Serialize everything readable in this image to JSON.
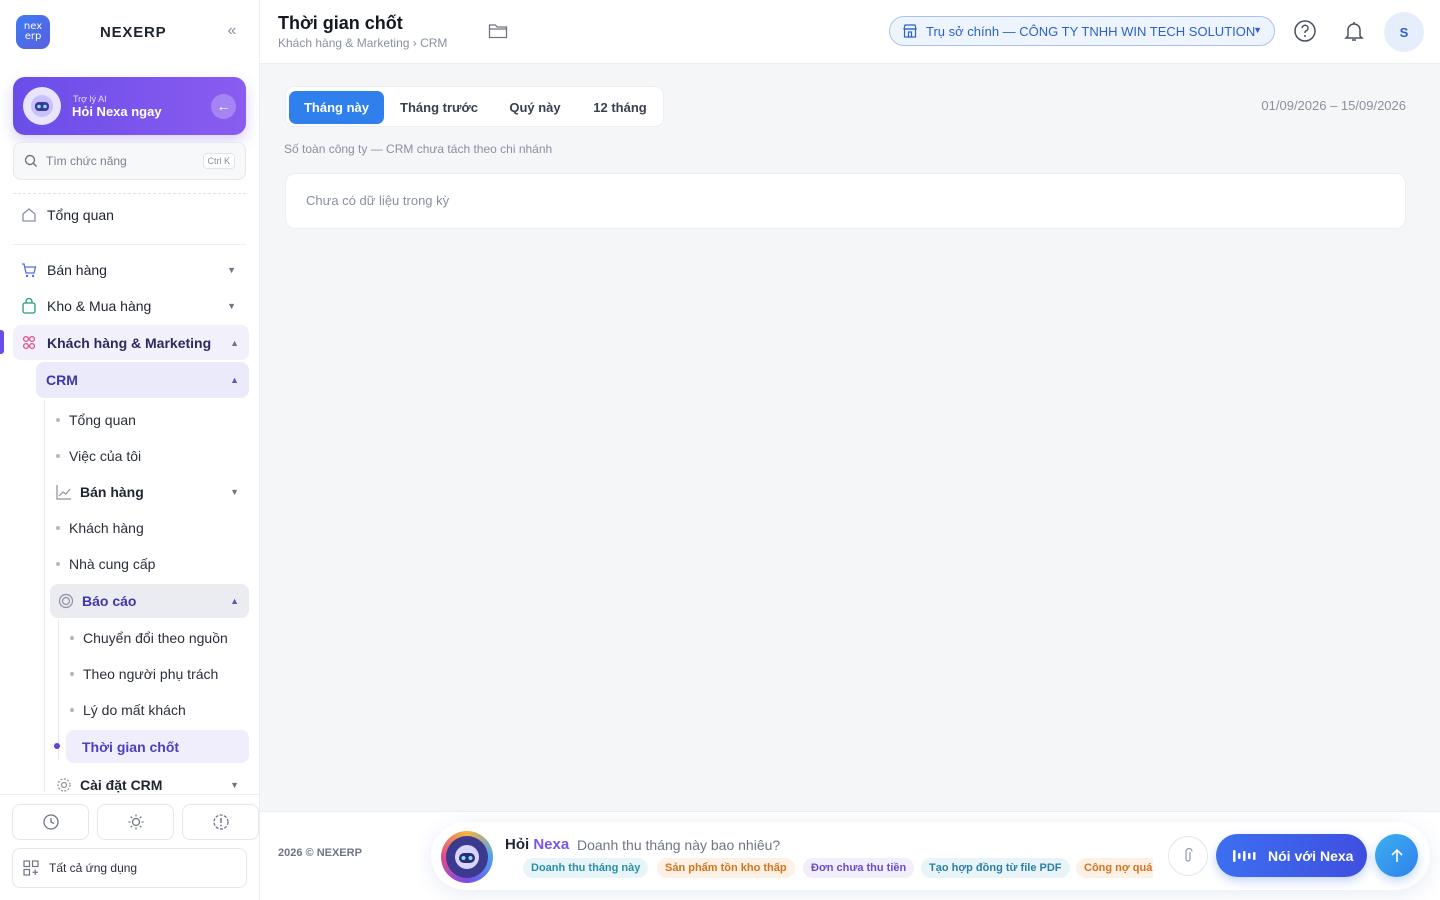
{
  "brand": {
    "logo_top": "nex",
    "logo_bottom": "erp",
    "name": "NEXERP",
    "collapse": "«"
  },
  "ai_card": {
    "subtitle": "Trợ lý AI",
    "title": "Hỏi Nexa ngay"
  },
  "search": {
    "placeholder": "Tìm chức năng",
    "shortcut": "Ctrl K"
  },
  "sidebar": {
    "overview": "Tổng quan",
    "groups": [
      {
        "label": "Bán hàng",
        "icon": "cart-icon",
        "expanded": false
      },
      {
        "label": "Kho & Mua hàng",
        "icon": "bag-icon",
        "expanded": false
      },
      {
        "label": "Khách hàng & Marketing",
        "icon": "people-icon",
        "expanded": true
      }
    ],
    "crm": {
      "label": "CRM",
      "items": [
        "Tổng quan",
        "Việc của tôi",
        "Bán hàng",
        "Khách hàng",
        "Nhà cung cấp"
      ],
      "reports": {
        "label": "Báo cáo",
        "items": [
          "Chuyển đổi theo nguồn",
          "Theo người phụ trách",
          "Lý do mất khách",
          "Thời gian chốt"
        ]
      },
      "settings": "Cài đặt CRM"
    },
    "footer": {
      "all_apps": "Tất cả ứng dụng"
    }
  },
  "header": {
    "title": "Thời gian chốt",
    "breadcrumb": "Khách hàng & Marketing › CRM",
    "branch": "Trụ sở chính — CÔNG TY TNHH WIN TECH SOLUTION",
    "avatar": "S"
  },
  "main": {
    "tabs": [
      "Tháng này",
      "Tháng trước",
      "Quý này",
      "12 tháng"
    ],
    "active_tab": 0,
    "date_range": "01/09/2026 – 15/09/2026",
    "note": "Số toàn công ty — CRM chưa tách theo chi nhánh",
    "empty": "Chưa có dữ liệu trong kỳ"
  },
  "footer": {
    "copyright": "2026 © NEXERP",
    "ask_prefix": "Hỏi",
    "ask_brand": "Nexa",
    "ask_placeholder": "Doanh thu tháng này bao nhiêu?",
    "chips": [
      {
        "label": "Doanh thu tháng này",
        "bg": "#e8f5f8",
        "color": "#2a8fa8"
      },
      {
        "label": "Sản phẩm tồn kho thấp",
        "bg": "#fdf0e4",
        "color": "#d4731f"
      },
      {
        "label": "Đơn chưa thu tiền",
        "bg": "#f2eefc",
        "color": "#6a4bd0"
      },
      {
        "label": "Tạo hợp đồng từ file PDF",
        "bg": "#e8f4f8",
        "color": "#2a7fa8"
      },
      {
        "label": "Công nợ quá hạn",
        "bg": "#fdf0e4",
        "color": "#d4731f"
      }
    ],
    "voice_label": "Nói với Nexa"
  },
  "colors": {
    "accent": "#2f80ed",
    "brand_purple": "#6a4de8"
  }
}
